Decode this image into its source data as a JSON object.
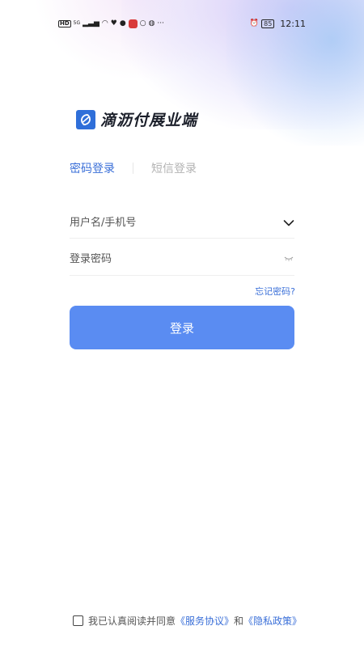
{
  "status_bar": {
    "left_hd": "HD",
    "left_net": "5G",
    "more": "···",
    "battery": "85",
    "time": "12:11"
  },
  "brand": {
    "name": "滴沥付展业端",
    "accent_color": "#2f6fd9"
  },
  "tabs": [
    {
      "label": "密码登录",
      "active": true
    },
    {
      "label": "短信登录",
      "active": false
    }
  ],
  "username": {
    "value": "",
    "placeholder": "用户名/手机号"
  },
  "password": {
    "value": "",
    "placeholder": "登录密码"
  },
  "forgot_label": "忘记密码?",
  "login_label": "登录",
  "agreement": {
    "prefix": "我已认真阅读并同意",
    "terms": "《服务协议》",
    "and": "和",
    "privacy": "《隐私政策》"
  },
  "colors": {
    "primary": "#5a8cf2",
    "link": "#3a6fd8"
  }
}
